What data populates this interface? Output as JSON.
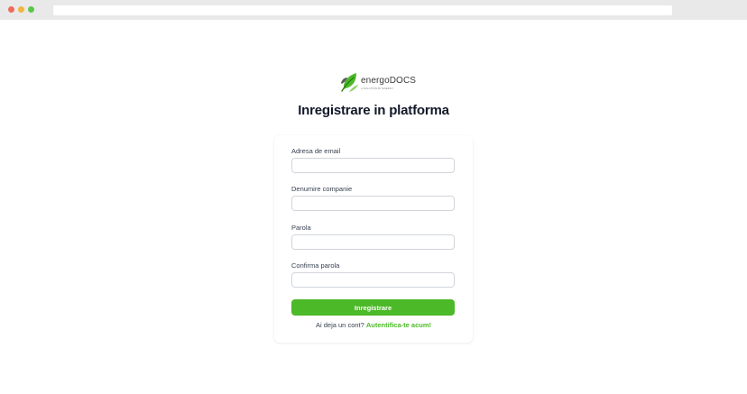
{
  "logo": {
    "name": "energoDOCS",
    "tagline": "A SOLUTION BY ENERGY"
  },
  "page": {
    "title": "Inregistrare in platforma"
  },
  "form": {
    "email_label": "Adresa de email",
    "email_value": "",
    "company_label": "Denumire companie",
    "company_value": "",
    "password_label": "Parola",
    "password_value": "",
    "confirm_label": "Confirma parola",
    "confirm_value": "",
    "submit_label": "Inregistrare",
    "signin_prompt": "Ai deja un cont?",
    "signin_link": "Autentifica-te acum!"
  },
  "colors": {
    "brand_green": "#4cb928",
    "title": "#111827",
    "border": "#d1d5db"
  }
}
